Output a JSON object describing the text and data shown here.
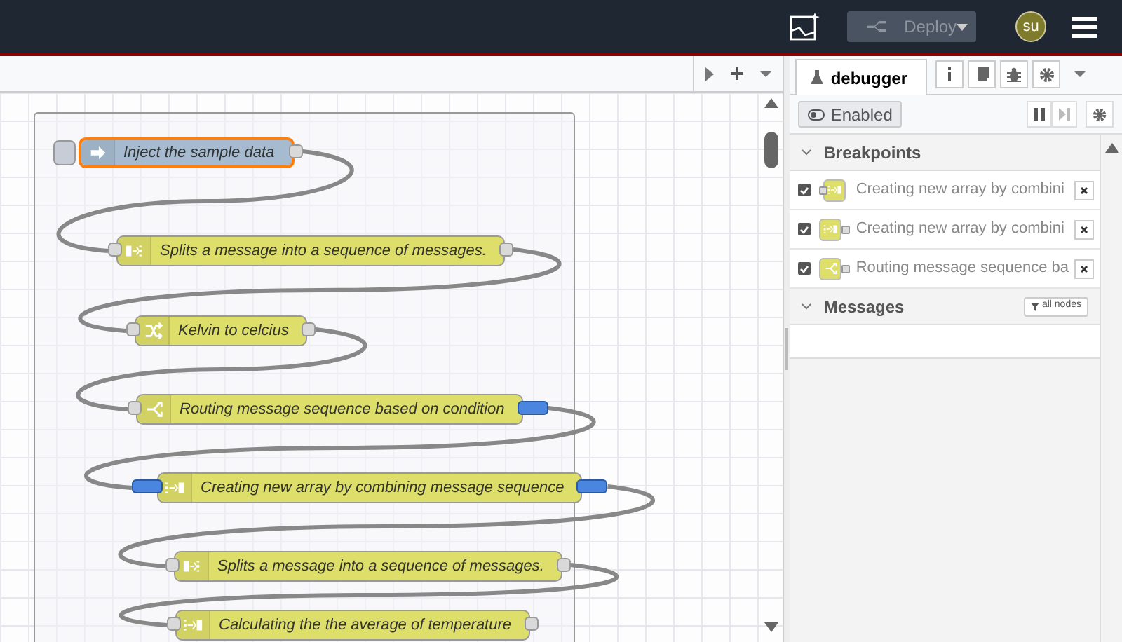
{
  "header": {
    "deploy": {
      "label": "Deploy",
      "disabled": true
    },
    "user": {
      "initials": "su"
    }
  },
  "sidebar": {
    "tab": {
      "label": "debugger",
      "selected": true
    },
    "enabled_toggle": {
      "label": "Enabled",
      "on": true
    },
    "sections": [
      {
        "kind": "breakpoints",
        "title": "Breakpoints",
        "expanded": true,
        "items": [
          {
            "label": "Creating new array by combini",
            "checked": true,
            "kind": "join_input"
          },
          {
            "label": "Creating new array by combini",
            "checked": true,
            "kind": "join_output"
          },
          {
            "label": "Routing message sequence ba",
            "checked": true,
            "kind": "switch_output"
          }
        ]
      },
      {
        "kind": "messages",
        "title": "Messages",
        "expanded": true,
        "filter": "all nodes"
      }
    ]
  },
  "flow": {
    "nodes": [
      {
        "kind": "inject",
        "label": "Inject the sample data",
        "selected": true,
        "breakpoint_out": false
      },
      {
        "kind": "split",
        "label": "Splits a message into a sequence of messages.",
        "selected": false,
        "breakpoint_in": false,
        "breakpoint_out": false
      },
      {
        "kind": "change",
        "label": "Kelvin to celcius",
        "selected": false,
        "breakpoint_in": false,
        "breakpoint_out": false
      },
      {
        "kind": "switch",
        "label": "Routing message sequence based on condition",
        "selected": false,
        "breakpoint_in": false,
        "breakpoint_out": true
      },
      {
        "kind": "join",
        "label": "Creating new array by combining message sequence",
        "selected": false,
        "breakpoint_in": true,
        "breakpoint_out": true
      },
      {
        "kind": "split",
        "label": "Splits a message into a sequence of messages.",
        "selected": false,
        "breakpoint_in": false,
        "breakpoint_out": false
      },
      {
        "kind": "join",
        "label": "Calculating the the average of temperature",
        "selected": false,
        "breakpoint_in": false,
        "breakpoint_out": false
      }
    ]
  }
}
